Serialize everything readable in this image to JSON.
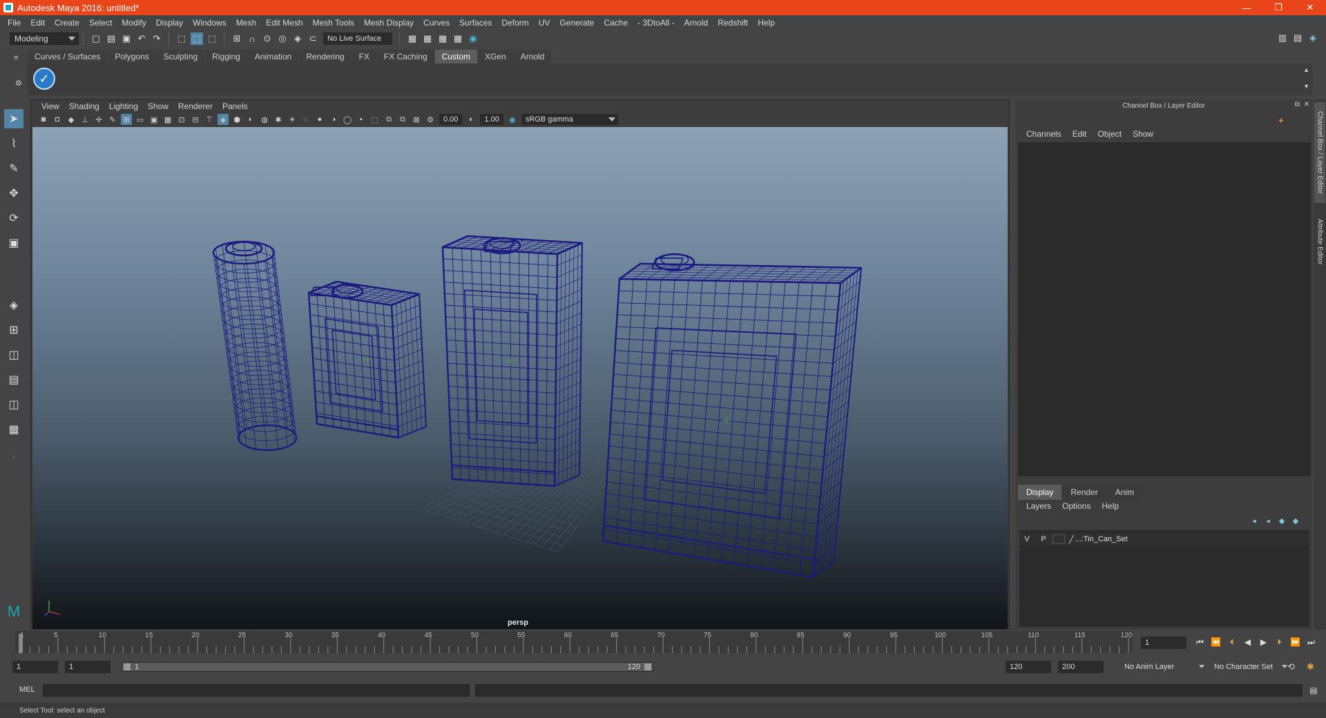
{
  "window": {
    "title": "Autodesk Maya 2016: untitled*",
    "controls": [
      "—",
      "❐",
      "✕"
    ]
  },
  "menubar": [
    "File",
    "Edit",
    "Create",
    "Select",
    "Modify",
    "Display",
    "Windows",
    "Mesh",
    "Edit Mesh",
    "Mesh Tools",
    "Mesh Display",
    "Curves",
    "Surfaces",
    "Deform",
    "UV",
    "Generate",
    "Cache",
    "- 3DtoAll -",
    "Arnold",
    "Redshift",
    "Help"
  ],
  "statusline": {
    "menu_set": "Modeling",
    "live_surface": "No Live Surface"
  },
  "shelf": {
    "tabs": [
      "Curves / Surfaces",
      "Polygons",
      "Sculpting",
      "Rigging",
      "Animation",
      "Rendering",
      "FX",
      "FX Caching",
      "Custom",
      "XGen",
      "Arnold"
    ],
    "active_tab": "Custom"
  },
  "viewport": {
    "menu": [
      "View",
      "Shading",
      "Lighting",
      "Show",
      "Renderer",
      "Panels"
    ],
    "exposure": "0.00",
    "gamma_value": "1.00",
    "color_space": "sRGB gamma",
    "camera_label": "persp"
  },
  "channel_box": {
    "header": "Channel Box / Layer Editor",
    "menu": [
      "Channels",
      "Edit",
      "Object",
      "Show"
    ]
  },
  "layer_editor": {
    "tabs": [
      "Display",
      "Render",
      "Anim"
    ],
    "active_tab": "Display",
    "menu": [
      "Layers",
      "Options",
      "Help"
    ],
    "layers": [
      {
        "v": "V",
        "p": "P",
        "name": "...:Tin_Can_Set"
      }
    ]
  },
  "side_tabs": [
    "Channel Box / Layer Editor",
    "Attribute Editor"
  ],
  "timeline": {
    "tick_labels": [
      1,
      5,
      10,
      15,
      20,
      25,
      30,
      35,
      40,
      45,
      50,
      55,
      60,
      65,
      70,
      75,
      80,
      85,
      90,
      95,
      100,
      105,
      110,
      115,
      120
    ],
    "min": 1,
    "max": 120,
    "current_frame": "1"
  },
  "range": {
    "start_field": "1",
    "playback_start_field": "1",
    "slider_start": "1",
    "slider_end": "120",
    "playback_end_field": "120",
    "end_field": "200",
    "anim_layer": "No Anim Layer",
    "character_set": "No Character Set"
  },
  "command_line": {
    "label": "MEL"
  },
  "help_line": "Select Tool: select an object",
  "colors": {
    "title_bar": "#e8461a",
    "wireframe": "#1a1a80",
    "active_tool": "#5285a6"
  }
}
